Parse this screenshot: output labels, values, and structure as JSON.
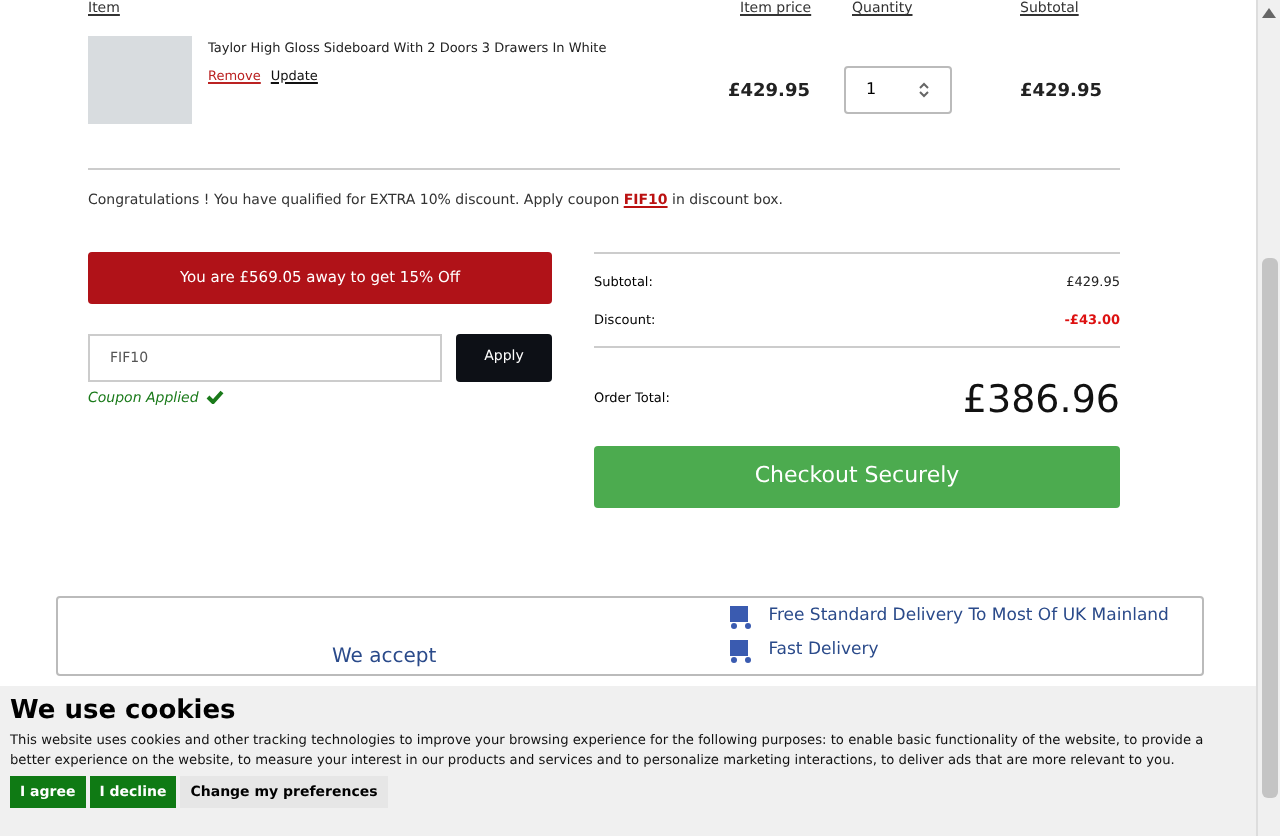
{
  "cart": {
    "columns": [
      "Item",
      "Item price",
      "Quantity",
      "Subtotal"
    ],
    "items": [
      {
        "name": "Taylor High Gloss Sideboard With 2 Doors 3 Drawers In White",
        "remove": "Remove",
        "update": "Update",
        "price": "£429.95",
        "quantity": "1",
        "subtotal": "£429.95"
      }
    ]
  },
  "promo": {
    "text": "Congratulations ! You have qualified for EXTRA 10% discount. Apply coupon ",
    "coupon": "FIF10",
    "after": " in discount box."
  },
  "banner": "You are £569.05 away to get 15% Off",
  "coupon": {
    "value": "FIF10",
    "button": "Apply",
    "status": "Coupon Applied",
    "applied": true
  },
  "totals": [
    {
      "label": "Subtotal:",
      "value": "£429.95",
      "kind": "normal"
    },
    {
      "label": "Discount:",
      "value": "-£43.00",
      "kind": "discount"
    }
  ],
  "order_total": {
    "label": "Order Total:",
    "value": "£386.96"
  },
  "checkout": "Checkout Securely",
  "footer": {
    "accept": "We accept",
    "delivery": [
      "Free Standard Delivery To Most Of UK Mainland",
      "Fast Delivery"
    ]
  },
  "cookies": {
    "title": "We use cookies",
    "text": "This website uses cookies and other tracking technologies to improve your browsing experience for the following purposes: to enable basic functionality of the website, to provide a better experience on the website, to measure your interest in our products and services and to personalize marketing interactions, to deliver ads that are more relevant to you.",
    "buttons": [
      {
        "label": "I agree",
        "kind": "primary"
      },
      {
        "label": "I decline",
        "kind": "primary"
      },
      {
        "label": "Change my preferences",
        "kind": "secondary"
      }
    ]
  }
}
